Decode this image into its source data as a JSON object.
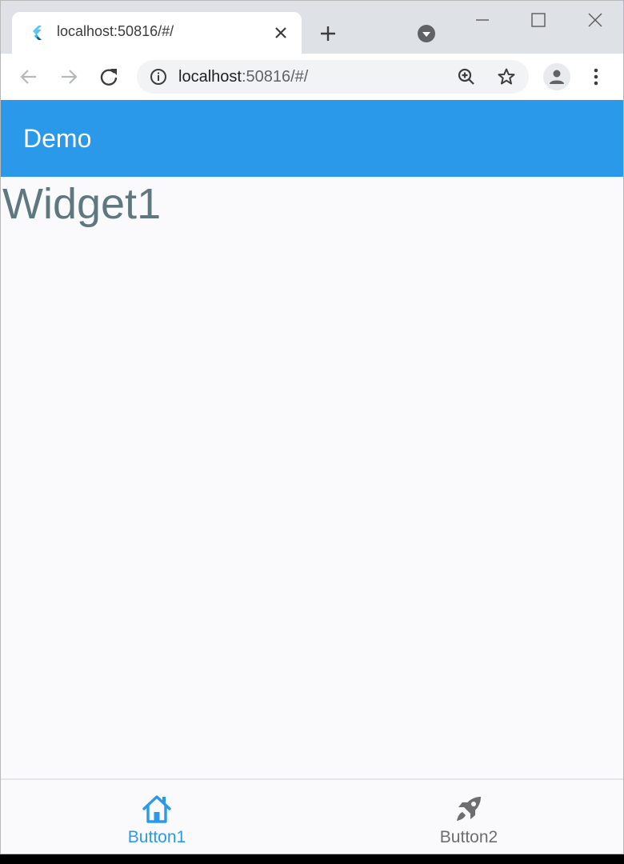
{
  "browser": {
    "tab": {
      "title": "localhost:50816/#/"
    },
    "address": {
      "host": "localhost",
      "rest": ":50816/#/"
    }
  },
  "app": {
    "appbar_title": "Demo",
    "body_text": "Widget1",
    "bottom_nav": {
      "items": [
        {
          "label": "Button1",
          "icon": "home-icon",
          "active": true
        },
        {
          "label": "Button2",
          "icon": "rocket-icon",
          "active": false
        }
      ]
    }
  },
  "colors": {
    "primary": "#2b99ea",
    "body_text": "#5f7880",
    "inactive": "#6e6e6e"
  }
}
